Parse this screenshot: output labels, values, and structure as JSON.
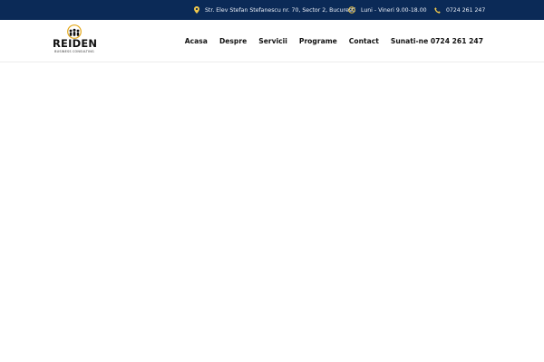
{
  "topbar": {
    "address": {
      "icon": "location-pin-icon",
      "text": "Str. Elev Stefan Stefanescu nr. 70, Sector 2, Bucuresti"
    },
    "hours": {
      "icon": "clock-icon",
      "text": "Luni - Vineri 9.00-18.00"
    },
    "phone": {
      "icon": "phone-icon",
      "text": "0724 261 247"
    },
    "colors": {
      "background": "#0b2a57",
      "icon_accent": "#f2c94c"
    }
  },
  "logo": {
    "brand": "REIDEN",
    "tagline": "BUSINESS CONSULTING"
  },
  "nav": {
    "items": [
      {
        "label": "Acasa"
      },
      {
        "label": "Despre"
      },
      {
        "label": "Servicii"
      },
      {
        "label": "Programe"
      },
      {
        "label": "Contact"
      },
      {
        "label": "Sunati-ne 0724 261 247"
      }
    ]
  }
}
